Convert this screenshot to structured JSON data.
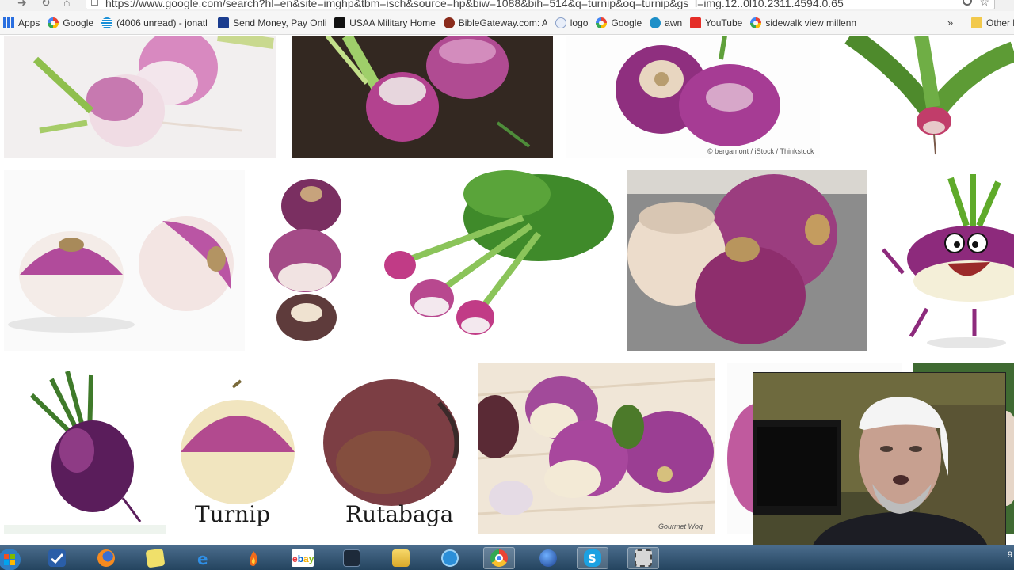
{
  "browser": {
    "url": "https://www.google.com/search?hl=en&site=imghp&tbm=isch&source=hp&biw=1088&bih=514&q=turnip&oq=turnip&gs_l=img.12..0l10.2311.4594.0.65"
  },
  "bookmarks": [
    {
      "label": "Apps",
      "icon": "apps-grid-icon"
    },
    {
      "label": "Google",
      "icon": "google-icon"
    },
    {
      "label": "(4006 unread) - jonatl",
      "icon": "att-globe-icon"
    },
    {
      "label": "Send Money, Pay Onli",
      "icon": "paypal-icon"
    },
    {
      "label": "USAA Military Home",
      "icon": "usaa-icon"
    },
    {
      "label": "BibleGateway.com: A",
      "icon": "biblegateway-icon"
    },
    {
      "label": "logo",
      "icon": "logo-icon"
    },
    {
      "label": "Google",
      "icon": "google-icon"
    },
    {
      "label": "awn",
      "icon": "awn-icon"
    },
    {
      "label": "YouTube",
      "icon": "youtube-icon"
    },
    {
      "label": "sidewalk view millenn",
      "icon": "google-icon"
    }
  ],
  "other_bookmarks": {
    "label": "Other b",
    "icon": "folder-icon"
  },
  "overflow_chevron": "»",
  "results": {
    "credit_bergamont": "© bergamont / iStock / Thinkstock",
    "caption_turnip": "Turnip",
    "caption_rutabaga": "Rutabaga",
    "credit_gourmet": "Gourmet Woq"
  },
  "taskbar": {
    "items": [
      "start-orb-icon",
      "taskbar-app-icon",
      "firefox-icon",
      "sticky-notes-icon",
      "internet-explorer-icon",
      "flame-app-icon",
      "ebay-icon",
      "media-app-icon",
      "file-explorer-icon",
      "web-app-icon",
      "chrome-icon",
      "google-earth-icon",
      "skype-icon",
      "snipping-tool-icon"
    ],
    "active": [
      "chrome-icon",
      "skype-icon",
      "snipping-tool-icon"
    ],
    "clock": "9"
  }
}
